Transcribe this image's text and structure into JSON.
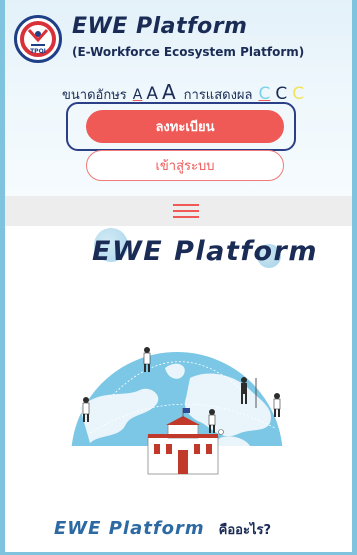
{
  "header": {
    "logo_text": "TPQI",
    "title": "EWE Platform",
    "subtitle": "(E-Workforce Ecosystem Platform)",
    "font_size_label": "ขนาดอักษร",
    "font_sizes": [
      "A",
      "A",
      "A"
    ],
    "display_mode_label": "การแสดงผล",
    "display_modes": [
      "C",
      "C",
      "C"
    ],
    "colors": {
      "brand_navy": "#1a2c55",
      "accent_red": "#ef5a57",
      "mode_cyan": "#7dd2e8",
      "mode_yellow": "#f3e35c",
      "frame_blue": "#7fc3df"
    }
  },
  "actions": {
    "register_label": "ลงทะเบียน",
    "login_label": "เข้าสู่ระบบ"
  },
  "menu": {
    "icon": "hamburger-menu-icon"
  },
  "hero": {
    "title": "EWE Platform",
    "illustration": "globe-with-people-and-building"
  },
  "about": {
    "title": "EWE Platform",
    "question": "คืออะไร?"
  }
}
